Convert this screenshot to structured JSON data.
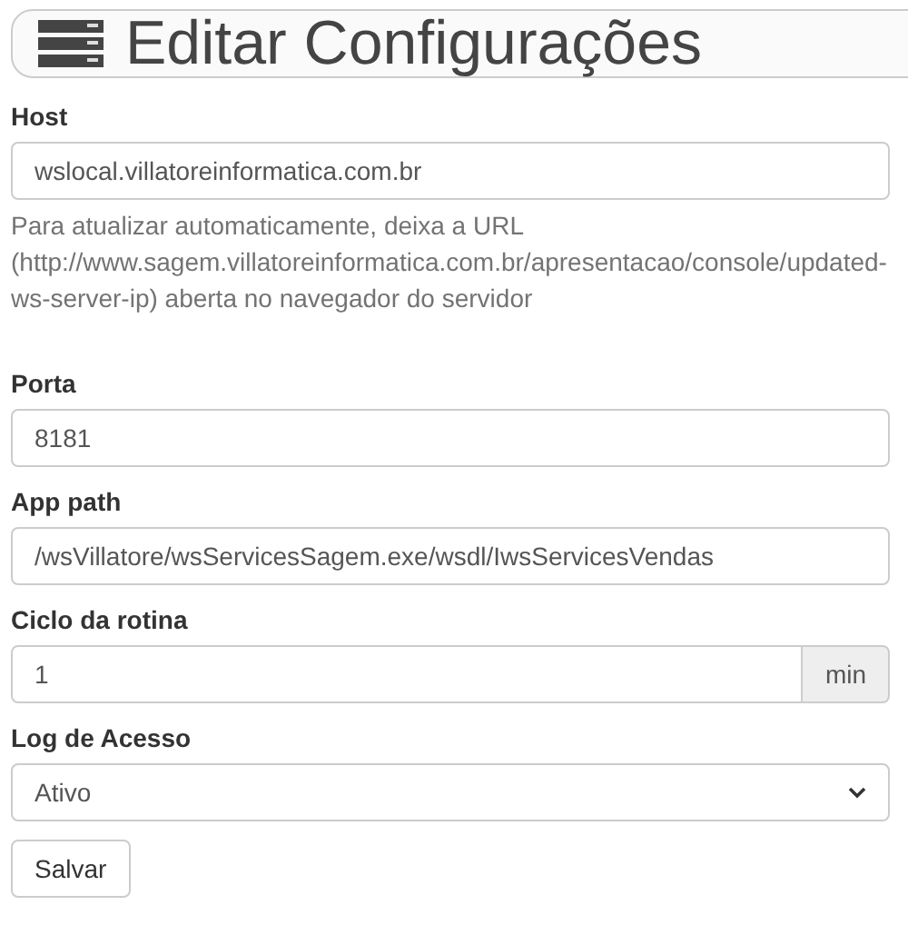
{
  "header": {
    "title": "Editar Configurações"
  },
  "fields": [
    {
      "kind": "text",
      "label": "Host",
      "value": "wslocal.villatoreinformatica.com.br",
      "help": "Para atualizar automaticamente, deixa a URL (http://www.sagem.villatoreinformatica.com.br/apresentacao/console/updated-ws-server-ip) aberta no navegador do servidor"
    },
    {
      "kind": "text",
      "label": "Porta",
      "value": "8181"
    },
    {
      "kind": "text",
      "label": "App path",
      "value": "/wsVillatore/wsServicesSagem.exe/wsdl/IwsServicesVendas"
    },
    {
      "kind": "addon",
      "label": "Ciclo da rotina",
      "value": "1",
      "addon": "min"
    },
    {
      "kind": "select",
      "label": "Log de Acesso",
      "value": "Ativo"
    }
  ],
  "save_button": "Salvar"
}
